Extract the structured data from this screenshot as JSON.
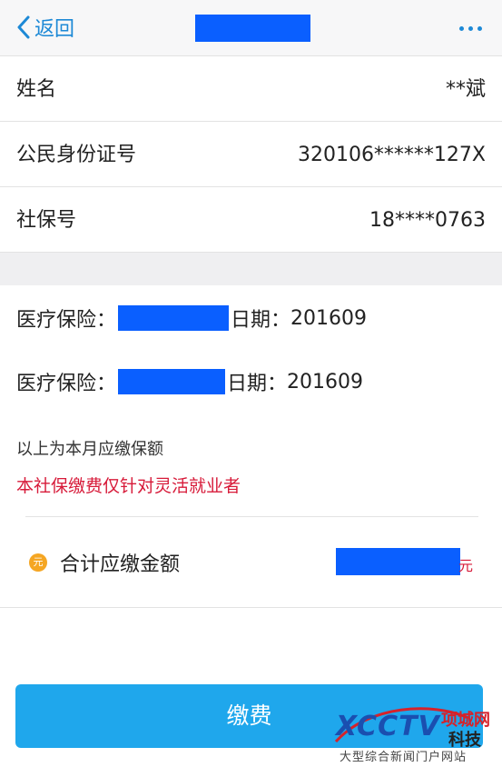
{
  "nav": {
    "back_label": "返回"
  },
  "info": [
    {
      "label": "姓名",
      "value": "**斌"
    },
    {
      "label": "公民身份证号",
      "value": "320106******127X"
    },
    {
      "label": "社保号",
      "value": "18****0763"
    }
  ],
  "items": [
    {
      "prefix": "医疗保险：",
      "date_label": "日期：",
      "date_value": "201609"
    },
    {
      "prefix": "医疗保险：",
      "date_label": "日期：",
      "date_value": "201609"
    }
  ],
  "note": "以上为本月应缴保额",
  "warning": "本社保缴费仅针对灵活就业者",
  "total": {
    "coin_text": "元",
    "label": "合计应缴金额",
    "unit": "元"
  },
  "pay_button": "缴费",
  "watermark": {
    "logo": "XCCTV",
    "cn_name": "项城网",
    "cn_sub": "科技",
    "tagline": "大型综合新闻门户网站"
  },
  "colors": {
    "accent": "#1d89d6",
    "button": "#1fa7ec",
    "warning": "#d71a39",
    "redaction": "#0a5fff",
    "coin": "#f5a623"
  }
}
